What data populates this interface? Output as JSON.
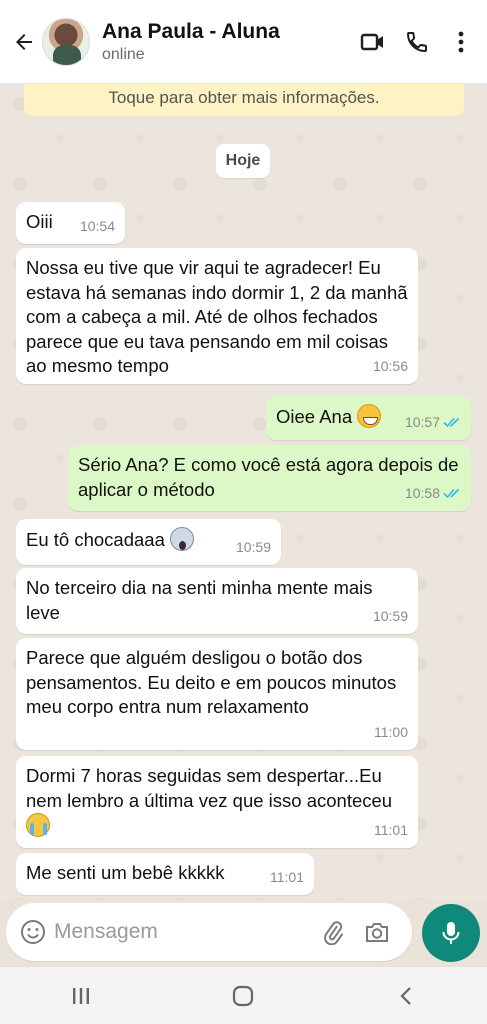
{
  "header": {
    "contact_name": "Ana Paula - Aluna",
    "status": "online"
  },
  "chat": {
    "notice_text": "Toque para obter mais informações.",
    "date_label": "Hoje",
    "messages": [
      {
        "dir": "in",
        "text": "Oiii",
        "time": "10:54"
      },
      {
        "dir": "in",
        "text": "Nossa eu tive que vir aqui te agradecer! Eu estava há semanas indo dormir 1, 2 da manhã com a cabeça a mil. Até de olhos fechados parece que eu tava pensando em mil coisas ao mesmo tempo",
        "time": "10:56"
      },
      {
        "dir": "out",
        "text": "Oiee Ana",
        "time": "10:57",
        "read": true
      },
      {
        "dir": "out",
        "text": "Sério Ana? E como você está agora depois de aplicar o método",
        "time": "10:58",
        "read": true
      },
      {
        "dir": "in",
        "text": "Eu tô chocadaaa",
        "time": "10:59"
      },
      {
        "dir": "in",
        "text": "No terceiro dia na senti minha mente mais leve",
        "time": "10:59"
      },
      {
        "dir": "in",
        "text": "Parece que alguém desligou o botão dos pensamentos. Eu deito e em poucos minutos meu corpo entra num relaxamento",
        "time": "11:00"
      },
      {
        "dir": "in",
        "text": "Dormi 7 horas seguidas sem despertar...Eu nem lembro a última vez que isso aconteceu",
        "time": "11:01"
      },
      {
        "dir": "in",
        "text": "Me senti um bebê kkkkk",
        "time": "11:01"
      }
    ]
  },
  "composer": {
    "placeholder": "Mensagem"
  },
  "colors": {
    "outgoing_bubble": "#dbf8c6",
    "incoming_bubble": "#ffffff",
    "accent": "#0f8a7a",
    "read_ticks": "#34b7f1"
  }
}
